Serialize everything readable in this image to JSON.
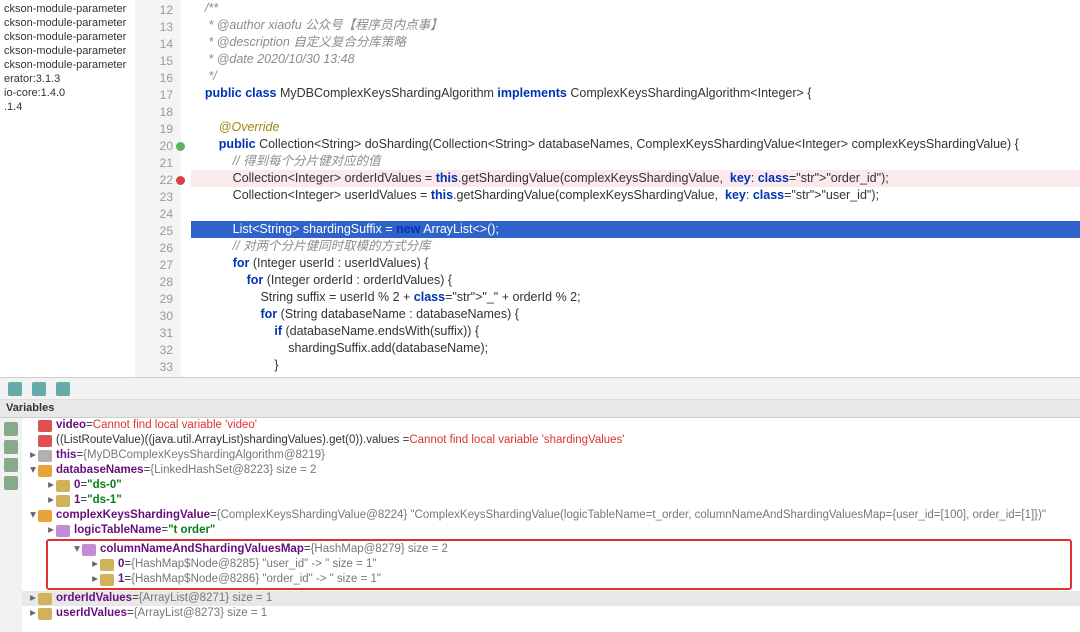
{
  "project": {
    "items": [
      "ckson-module-parameter",
      "ckson-module-parameter",
      "ckson-module-parameter",
      "ckson-module-parameter",
      "ckson-module-parameter",
      "erator:3.1.3",
      "",
      "io-core:1.4.0",
      ".1.4"
    ]
  },
  "gutter_start": 12,
  "code_lines": [
    {
      "n": 12,
      "t": "    /**"
    },
    {
      "n": 13,
      "t": "     * @author xiaofu 公众号【程序员内点事】"
    },
    {
      "n": 14,
      "t": "     * @description 自定义复合分库策略"
    },
    {
      "n": 15,
      "t": "     * @date 2020/10/30 13:48"
    },
    {
      "n": 16,
      "t": "     */"
    },
    {
      "n": 17,
      "t": "    public class MyDBComplexKeysShardingAlgorithm implements ComplexKeysShardingAlgorithm<Integer> {"
    },
    {
      "n": 18,
      "t": ""
    },
    {
      "n": 19,
      "t": "        @Override"
    },
    {
      "n": 20,
      "t": "        public Collection<String> doSharding(Collection<String> databaseNames, ComplexKeysShardingValue<Integer> complexKeysShardingValue) {",
      "ov": true
    },
    {
      "n": 21,
      "t": "            // 得到每个分片健对应的值"
    },
    {
      "n": 22,
      "t": "            Collection<Integer> orderIdValues = this.getShardingValue(complexKeysShardingValue,  key: \"order_id\");",
      "bp": true
    },
    {
      "n": 23,
      "t": "            Collection<Integer> userIdValues = this.getShardingValue(complexKeysShardingValue,  key: \"user_id\");"
    },
    {
      "n": 24,
      "t": ""
    },
    {
      "n": 25,
      "t": "            List<String> shardingSuffix = new ArrayList<>();",
      "sel": true
    },
    {
      "n": 26,
      "t": "            // 对两个分片健同时取模的方式分库"
    },
    {
      "n": 27,
      "t": "            for (Integer userId : userIdValues) {"
    },
    {
      "n": 28,
      "t": "                for (Integer orderId : orderIdValues) {"
    },
    {
      "n": 29,
      "t": "                    String suffix = userId % 2 + \"_\" + orderId % 2;"
    },
    {
      "n": 30,
      "t": "                    for (String databaseName : databaseNames) {"
    },
    {
      "n": 31,
      "t": "                        if (databaseName.endsWith(suffix)) {"
    },
    {
      "n": 32,
      "t": "                            shardingSuffix.add(databaseName);"
    },
    {
      "n": 33,
      "t": "                        }"
    }
  ],
  "panel_title": "Variables",
  "vars": [
    {
      "d": 0,
      "ic": "err",
      "tw": "",
      "nm": "video",
      "rest": " = ",
      "err": "Cannot find local variable 'video'"
    },
    {
      "d": 0,
      "ic": "err",
      "tw": "",
      "nm": "",
      "rest": "((ListRouteValue)((java.util.ArrayList)shardingValues).get(0)).values = ",
      "err": "Cannot find local variable 'shardingValues'"
    },
    {
      "d": 0,
      "ic": "m",
      "tw": "▸",
      "nm": "this",
      "rest": " = ",
      "tx": "{MyDBComplexKeysShardingAlgorithm@8219}"
    },
    {
      "d": 0,
      "ic": "p",
      "tw": "▾",
      "nm": "databaseNames",
      "rest": " = ",
      "tx": "{LinkedHashSet@8223}  size = 2"
    },
    {
      "d": 1,
      "ic": "a",
      "tw": "▸",
      "nm": "0",
      "rest": " = ",
      "str": "\"ds-0\""
    },
    {
      "d": 1,
      "ic": "a",
      "tw": "▸",
      "nm": "1",
      "rest": " = ",
      "str": "\"ds-1\""
    },
    {
      "d": 0,
      "ic": "p",
      "tw": "▾",
      "nm": "complexKeysShardingValue",
      "rest": " = ",
      "tx": "{ComplexKeysShardingValue@8224} \"ComplexKeysShardingValue(logicTableName=t_order, columnNameAndShardingValuesMap={user_id=[100], order_id=[1]})\""
    },
    {
      "d": 1,
      "ic": "f",
      "tw": "▸",
      "nm": "logicTableName",
      "rest": " = ",
      "str": "\"t order\""
    }
  ],
  "boxed": [
    {
      "d": 1,
      "ic": "f",
      "tw": "▾",
      "nm": "columnNameAndShardingValuesMap",
      "rest": " = ",
      "tx": "{HashMap@8279}  size = 2"
    },
    {
      "d": 2,
      "ic": "a",
      "tw": "▸",
      "nm": "0",
      "rest": " = ",
      "tx": "{HashMap$Node@8285} \"user_id\" -> \" size = 1\""
    },
    {
      "d": 2,
      "ic": "a",
      "tw": "▸",
      "nm": "1",
      "rest": " = ",
      "tx": "{HashMap$Node@8286} \"order_id\" -> \" size = 1\""
    }
  ],
  "after": [
    {
      "d": 0,
      "ic": "a",
      "tw": "▸",
      "nm": "orderIdValues",
      "rest": " = ",
      "tx": "{ArrayList@8271}  size = 1",
      "hl": true
    },
    {
      "d": 0,
      "ic": "a",
      "tw": "▸",
      "nm": "userIdValues",
      "rest": " = ",
      "tx": "{ArrayList@8273}  size = 1"
    }
  ]
}
